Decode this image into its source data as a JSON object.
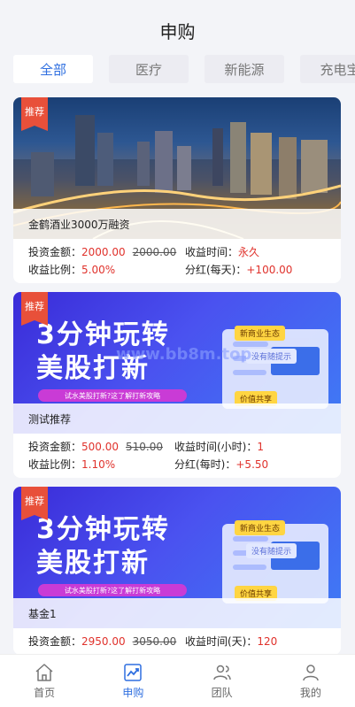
{
  "header": {
    "title": "申购"
  },
  "tabs": [
    {
      "label": "全部",
      "active": true
    },
    {
      "label": "医疗"
    },
    {
      "label": "新能源"
    },
    {
      "label": "充电宝"
    }
  ],
  "labels": {
    "amount": "投资金额：",
    "ratio": "收益比例：",
    "recommend": "推荐"
  },
  "products": [
    {
      "name": "金鹤酒业3000万融资",
      "amount": "2000.00",
      "original": "2000.00",
      "ratio": "5.00%",
      "period_label": "收益时间：",
      "period_value": "永久",
      "dividend_label": "分红(每天)：",
      "dividend_value": "+100.00",
      "banner": "city"
    },
    {
      "name": "测试推荐",
      "amount": "500.00",
      "original": "510.00",
      "ratio": "1.10%",
      "period_label": "收益时间(小时)：",
      "period_value": "1",
      "dividend_label": "分红(每时)：",
      "dividend_value": "+5.50",
      "banner": "promo"
    },
    {
      "name": "基金1",
      "amount": "2950.00",
      "original": "3050.00",
      "period_label": "收益时间(天)：",
      "period_value": "120",
      "banner": "promo"
    }
  ],
  "promo": {
    "line1": "3分钟玩转",
    "line2": "美股打新",
    "strip": "试水美股打新?这了解打新攻略",
    "tag1": "新商业生态",
    "tag2": "价值共享",
    "tag3": "没有随提示"
  },
  "watermark": "www.bb8m.top",
  "tabbar": [
    {
      "label": "首页",
      "icon": "home-icon"
    },
    {
      "label": "申购",
      "icon": "chart-icon",
      "active": true
    },
    {
      "label": "团队",
      "icon": "team-icon"
    },
    {
      "label": "我的",
      "icon": "user-icon"
    }
  ],
  "colors": {
    "accent": "#2f6fe0",
    "red": "#e0322c",
    "badge": "#e8503a"
  }
}
